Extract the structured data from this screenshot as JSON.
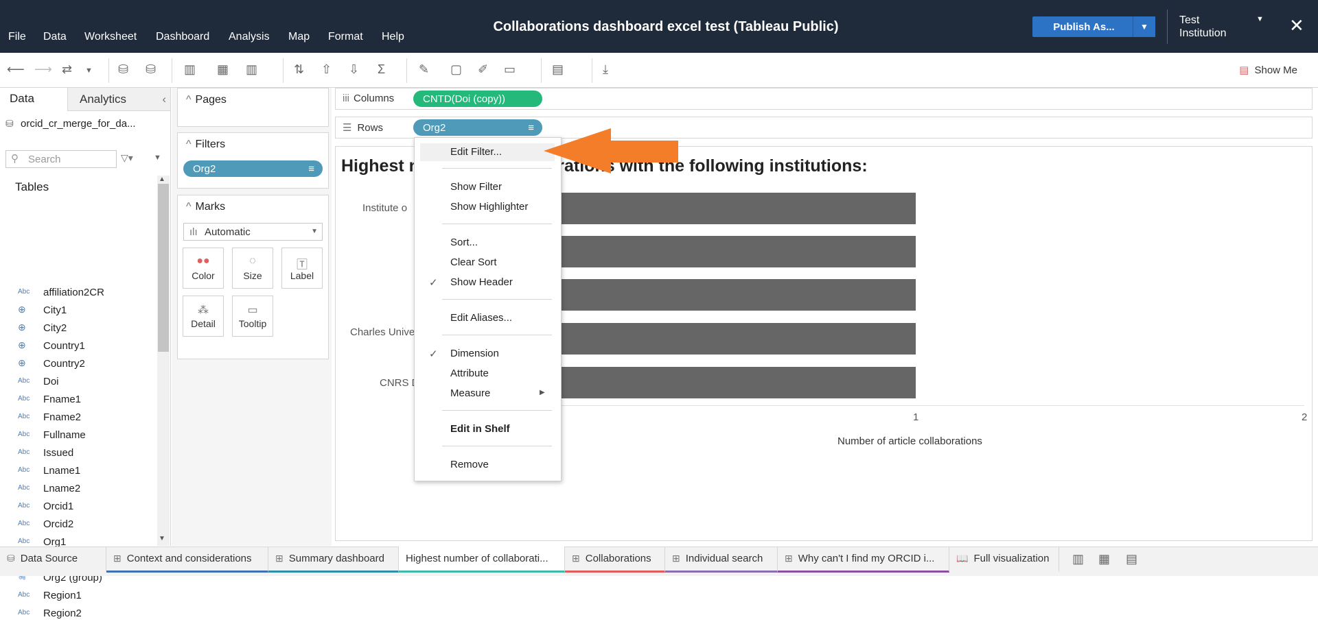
{
  "app": {
    "title": "Collaborations dashboard excel test (Tableau Public)",
    "menu": [
      "File",
      "Data",
      "Worksheet",
      "Dashboard",
      "Analysis",
      "Map",
      "Format",
      "Help"
    ],
    "publish_label": "Publish As...",
    "institution_line1": "Test",
    "institution_line2": "Institution",
    "show_me": "Show Me"
  },
  "left": {
    "tab_data": "Data",
    "tab_analytics": "Analytics",
    "datasource": "orcid_cr_merge_for_da...",
    "search_placeholder": "Search",
    "tables_heading": "Tables",
    "fields": [
      {
        "type": "Abc",
        "name": "affiliation2CR"
      },
      {
        "type": "globe",
        "name": "City1"
      },
      {
        "type": "globe",
        "name": "City2"
      },
      {
        "type": "globe",
        "name": "Country1"
      },
      {
        "type": "globe",
        "name": "Country2"
      },
      {
        "type": "Abc",
        "name": "Doi"
      },
      {
        "type": "Abc",
        "name": "Fname1"
      },
      {
        "type": "Abc",
        "name": "Fname2"
      },
      {
        "type": "Abc",
        "name": "Fullname"
      },
      {
        "type": "Abc",
        "name": "Issued"
      },
      {
        "type": "Abc",
        "name": "Lname1"
      },
      {
        "type": "Abc",
        "name": "Lname2"
      },
      {
        "type": "Abc",
        "name": "Orcid1"
      },
      {
        "type": "Abc",
        "name": "Orcid2"
      },
      {
        "type": "Abc",
        "name": "Org1"
      },
      {
        "type": "Abc",
        "name": "Org2"
      },
      {
        "type": "clip",
        "name": "Org2 (group)"
      },
      {
        "type": "Abc",
        "name": "Region1"
      },
      {
        "type": "Abc",
        "name": "Region2"
      }
    ]
  },
  "cards": {
    "pages": "Pages",
    "filters": "Filters",
    "filter_pill": "Org2",
    "marks": "Marks",
    "mark_type": "Automatic",
    "buttons": [
      "Color",
      "Size",
      "Label",
      "Detail",
      "Tooltip"
    ]
  },
  "shelves": {
    "columns_label": "Columns",
    "columns_pill": "CNTD(Doi (copy))",
    "rows_label": "Rows",
    "rows_pill": "Org2"
  },
  "view": {
    "title": "Highest number of collaborations with the following institutions:",
    "row_labels_visible": [
      "Institute o",
      "Charles Unive",
      "CNRS D"
    ],
    "tick_labels": [
      "1",
      "2"
    ],
    "axis_label": "Number of article collaborations",
    "bar_color": "#666666"
  },
  "chart_data": {
    "type": "bar",
    "orientation": "horizontal",
    "title": "Highest number of collaborations with the following institutions:",
    "xlabel": "Number of article collaborations",
    "xlim": [
      0,
      2
    ],
    "categories_partially_visible": [
      "Institute o",
      "",
      "",
      "Charles Unive",
      "CNRS D"
    ],
    "values": [
      1,
      1,
      1,
      1,
      1
    ]
  },
  "context_menu": {
    "items": {
      "edit_filter": "Edit Filter...",
      "show_filter": "Show Filter",
      "show_highlighter": "Show Highlighter",
      "sort": "Sort...",
      "clear_sort": "Clear Sort",
      "show_header": "Show Header",
      "edit_aliases": "Edit Aliases...",
      "dimension": "Dimension",
      "attribute": "Attribute",
      "measure": "Measure",
      "edit_in_shelf": "Edit in Shelf",
      "remove": "Remove"
    },
    "check_mark": "✓"
  },
  "annotation": {
    "arrow_color": "#f47d2a"
  },
  "tabs": [
    {
      "label": "Data Source",
      "color": "#f2f2f2"
    },
    {
      "label": "Context and considerations",
      "color": "#3f6fb5"
    },
    {
      "label": "Summary dashboard",
      "color": "#2f8fa8"
    },
    {
      "label": "Highest number of collaborati...",
      "color": "#3fb9a8"
    },
    {
      "label": "Collaborations",
      "color": "#e25c5c"
    },
    {
      "label": "Individual search",
      "color": "#8a6fb0"
    },
    {
      "label": "Why can't I find my ORCID i...",
      "color": "#8a4fa0"
    },
    {
      "label": "Full visualization",
      "color": "#f2f2f2"
    }
  ]
}
